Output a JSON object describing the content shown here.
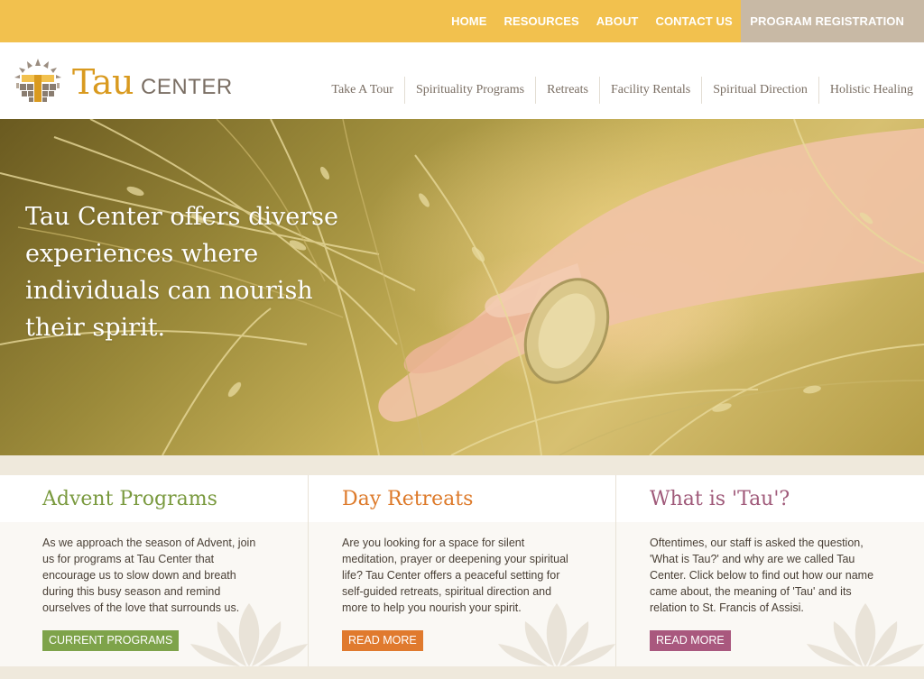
{
  "topnav": {
    "items": [
      "HOME",
      "RESOURCES",
      "ABOUT",
      "CONTACT US"
    ],
    "registration": "PROGRAM REGISTRATION"
  },
  "brand": {
    "tau": "Tau",
    "center": "CENTER"
  },
  "mainnav": {
    "items": [
      "Take A Tour",
      "Spirituality Programs",
      "Retreats",
      "Facility Rentals",
      "Spiritual Direction",
      "Holistic Healing"
    ]
  },
  "hero": {
    "headline": "Tau Center offers diverse experiences where individuals can nourish their spirit."
  },
  "cards": [
    {
      "title": "Advent Programs",
      "color": "#7a9a3f",
      "body": "As we approach the season of Advent, join us for programs at Tau Center that encourage us to slow down and breath during this busy season and remind ourselves of the love that surrounds us.",
      "button": "CURRENT PROGRAMS",
      "button_color": "#7ea34a"
    },
    {
      "title": "Day Retreats",
      "color": "#dd7a2a",
      "body": "Are you looking for a space for silent meditation, prayer or deepening your spiritual life? Tau Center offers a peaceful setting for self-guided retreats, spiritual direction and more to help you nourish your spirit.",
      "button": "READ MORE",
      "button_color": "#e07a2e"
    },
    {
      "title": "What is 'Tau'?",
      "color": "#a05a7a",
      "body": "Oftentimes, our staff is asked the question, 'What is Tau?' and why are we called Tau Center. Click below to find out how our name came about, the meaning of 'Tau' and its relation to St. Francis of Assisi.",
      "button": "READ MORE",
      "button_color": "#a9587e"
    }
  ],
  "colors": {
    "topbar": "#f2c14e",
    "registration_bg": "#c8b9a5",
    "brand_gold": "#d99a1f",
    "brand_gray": "#7a6e63"
  },
  "icons": [
    "tau-logo-icon",
    "lotus-decoration-icon"
  ]
}
